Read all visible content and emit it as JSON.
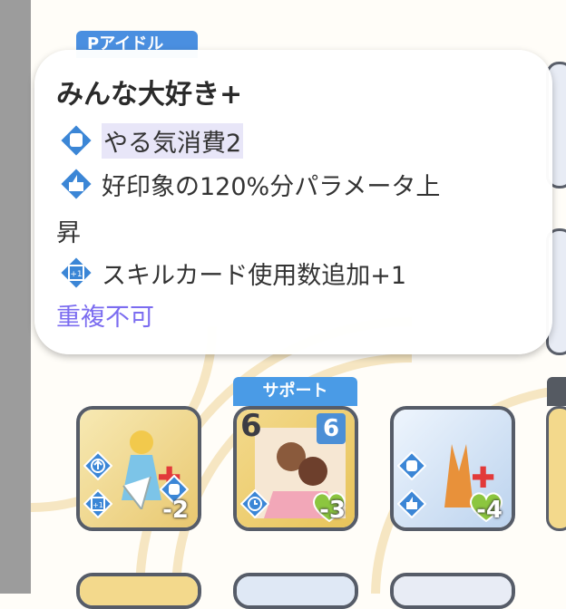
{
  "tags": {
    "p_idol": "Pアイドル",
    "support": "サポート"
  },
  "tooltip": {
    "title": "みんな大好き+",
    "effects": [
      {
        "icon": "fist-icon",
        "text": "やる気消費2",
        "highlight": "やる気"
      },
      {
        "icon": "thumbs-up-icon",
        "text": "好印象の120%分パラメータ上",
        "highlight": "好印象"
      },
      {
        "icon": "plus-one-icon",
        "text": "スキルカード使用数追加+1",
        "highlight": "スキルカード使用数追加"
      }
    ],
    "wrap_text": "昇",
    "note": "重複不可"
  },
  "cards": [
    {
      "name": "card-1",
      "value": "-2",
      "colors": [
        "#f7e9b3",
        "#e9c870"
      ]
    },
    {
      "name": "card-2",
      "cost": "6",
      "cost_badge": "6",
      "value": "-3",
      "colors": [
        "#f3d98c",
        "#e8c45a"
      ]
    },
    {
      "name": "card-3",
      "value": "-4",
      "colors": [
        "#e6f0fb",
        "#bcd3ee"
      ]
    }
  ],
  "colors": {
    "accent": "#4a8fe0",
    "note": "#7b6cf0",
    "card_border": "#565c68"
  }
}
